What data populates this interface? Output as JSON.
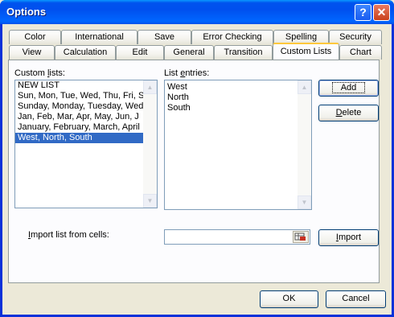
{
  "window": {
    "title": "Options",
    "help_label": "?",
    "close_label": "✕"
  },
  "tabs_row1": [
    {
      "label": "Color"
    },
    {
      "label": "International"
    },
    {
      "label": "Save"
    },
    {
      "label": "Error Checking"
    },
    {
      "label": "Spelling"
    },
    {
      "label": "Security"
    }
  ],
  "tabs_row2": [
    {
      "label": "View"
    },
    {
      "label": "Calculation"
    },
    {
      "label": "Edit"
    },
    {
      "label": "General"
    },
    {
      "label": "Transition"
    },
    {
      "label": "Custom Lists",
      "active": true
    },
    {
      "label": "Chart"
    }
  ],
  "custom_lists": {
    "label_prefix": "Custom ",
    "label_accel": "l",
    "label_suffix": "ists:",
    "items": [
      "NEW LIST",
      "Sun, Mon, Tue, Wed, Thu, Fri, S",
      "Sunday, Monday, Tuesday, Wed",
      "Jan, Feb, Mar, Apr, May, Jun, J",
      "January, February, March, April",
      "West, North, South"
    ],
    "selected_index": 5
  },
  "list_entries": {
    "label_prefix": "List ",
    "label_accel": "e",
    "label_suffix": "ntries:",
    "items": [
      "West",
      "North",
      "South"
    ]
  },
  "buttons": {
    "add": "Add",
    "delete_accel": "D",
    "delete_rest": "elete",
    "import_accel": "I",
    "import_rest": "mport",
    "ok": "OK",
    "cancel": "Cancel"
  },
  "import": {
    "label_accel": "I",
    "label_rest": "mport list from cells:",
    "value": ""
  },
  "icons": {
    "scroll_up": "up-arrow-icon",
    "scroll_down": "down-arrow-icon",
    "collapse": "range-select-icon"
  }
}
